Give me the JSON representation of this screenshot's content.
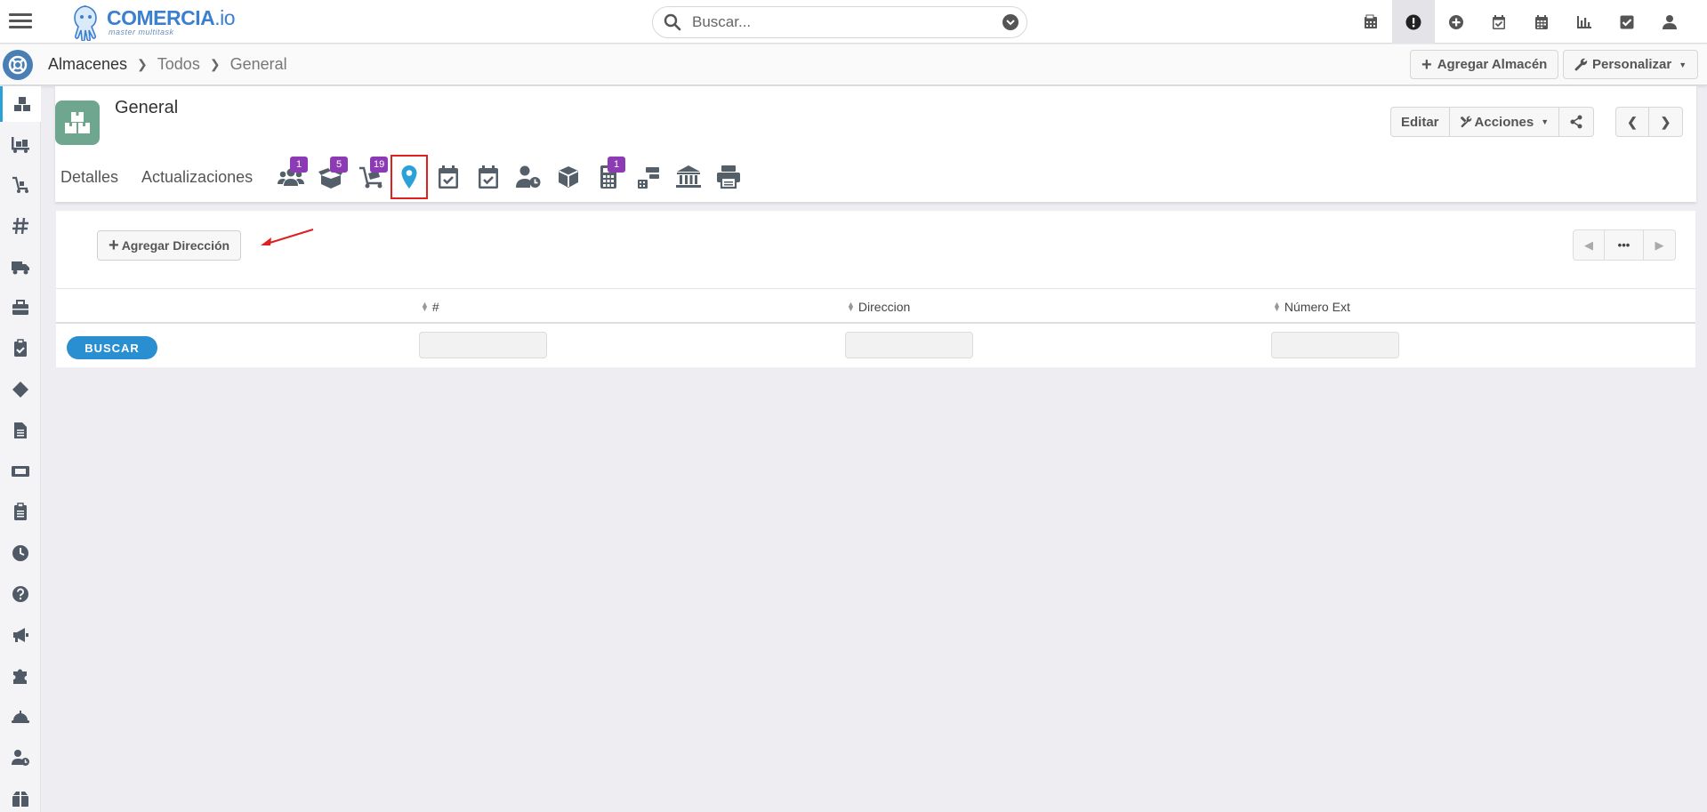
{
  "app": {
    "logo_name": "COMERCIA",
    "logo_suffix": ".io",
    "logo_tagline": "master multitask"
  },
  "search": {
    "placeholder": "Buscar..."
  },
  "top_icons": [
    "calculator-icon",
    "alert-icon",
    "plus-circle-icon",
    "calendar-check-icon",
    "calendar-icon",
    "chart-icon",
    "checkbox-icon",
    "user-icon"
  ],
  "breadcrumb": {
    "root": "Almacenes",
    "level1": "Todos",
    "current": "General"
  },
  "header_buttons": {
    "add": "Agregar Almacén",
    "customize": "Personalizar"
  },
  "record": {
    "title": "General",
    "edit": "Editar",
    "actions": "Acciones"
  },
  "tabs": {
    "details": "Detalles",
    "updates": "Actualizaciones",
    "badges": {
      "contacts": "1",
      "boxes": "5",
      "carts": "19",
      "calc": "1"
    }
  },
  "panel": {
    "add_button": "Agregar Dirección",
    "pager_more": "•••",
    "columns": {
      "num": "#",
      "address": "Direccion",
      "ext": "Número Ext"
    },
    "search_button": "BUSCAR"
  },
  "colors": {
    "accent": "#2aa2d8",
    "badge": "#8c3bb5",
    "highlight": "#e02020",
    "avatar": "#6fa690"
  }
}
